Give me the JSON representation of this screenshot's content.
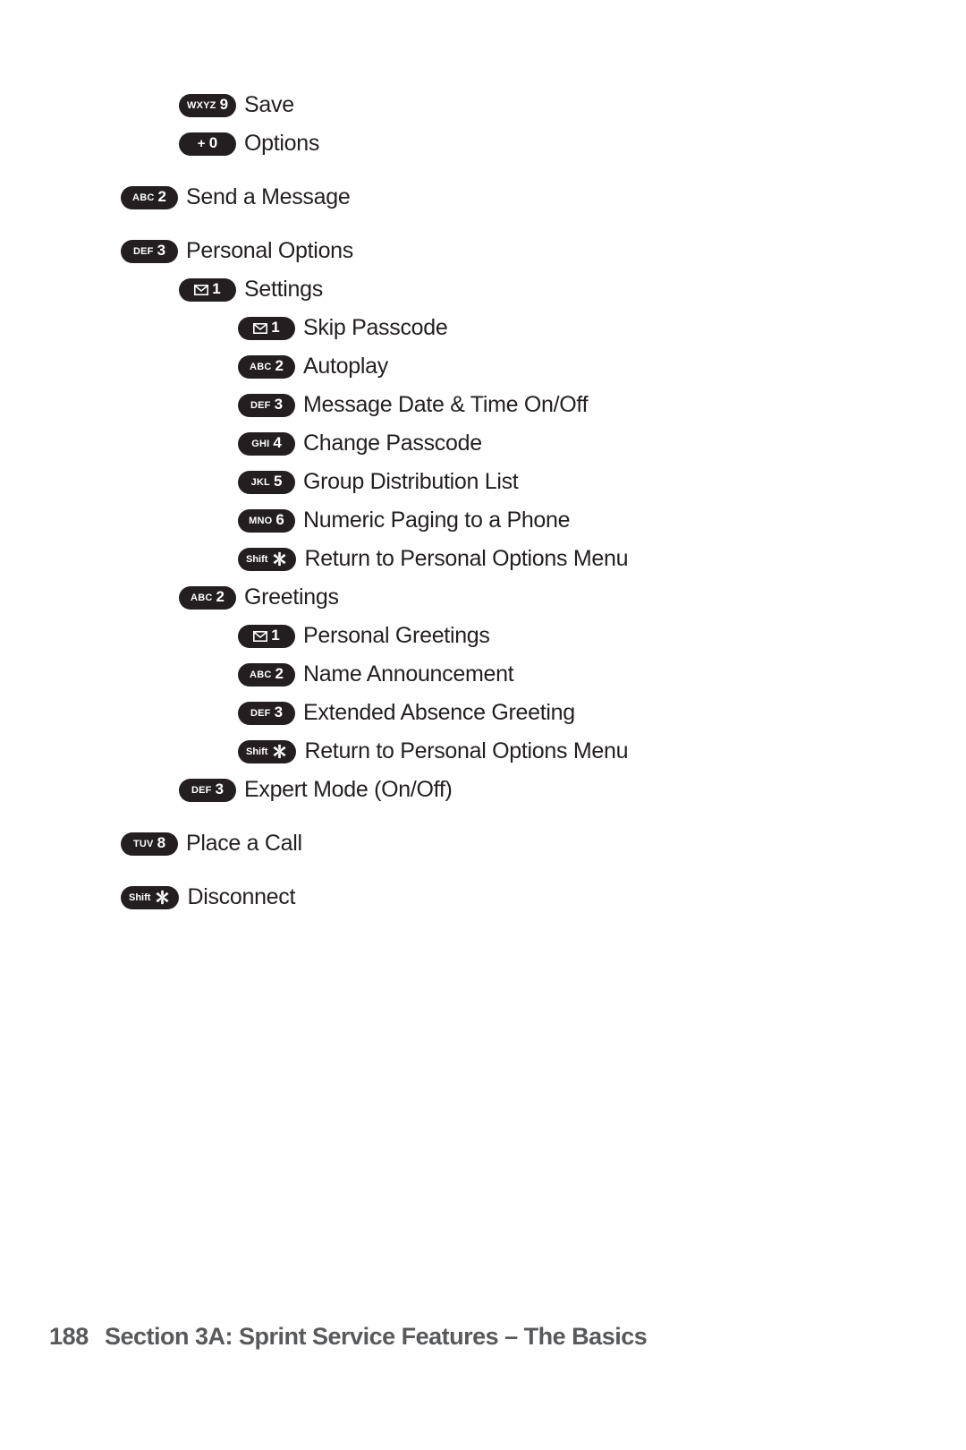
{
  "page": {
    "background_color": "#ffffff",
    "text_color": "#231f20",
    "key_color": "#231f20",
    "footer_color": "#58595b"
  },
  "menu": {
    "rows": [
      {
        "level": 1,
        "key": {
          "sub": "WXYZ",
          "digit": "9",
          "glyph": "none"
        },
        "label": "Save",
        "gap_before": false
      },
      {
        "level": 1,
        "key": {
          "sub": "+",
          "digit": "0",
          "glyph": "none"
        },
        "label": "Options",
        "gap_before": false
      },
      {
        "level": 0,
        "key": {
          "sub": "ABC",
          "digit": "2",
          "glyph": "none"
        },
        "label": "Send a Message",
        "gap_before": true
      },
      {
        "level": 0,
        "key": {
          "sub": "DEF",
          "digit": "3",
          "glyph": "none"
        },
        "label": "Personal Options",
        "gap_before": true
      },
      {
        "level": 1,
        "key": {
          "sub": "",
          "digit": "1",
          "glyph": "envelope"
        },
        "label": "Settings",
        "gap_before": false
      },
      {
        "level": 2,
        "key": {
          "sub": "",
          "digit": "1",
          "glyph": "envelope"
        },
        "label": "Skip Passcode",
        "gap_before": false
      },
      {
        "level": 2,
        "key": {
          "sub": "ABC",
          "digit": "2",
          "glyph": "none"
        },
        "label": "Autoplay",
        "gap_before": false
      },
      {
        "level": 2,
        "key": {
          "sub": "DEF",
          "digit": "3",
          "glyph": "none"
        },
        "label": "Message Date & Time On/Off",
        "gap_before": false
      },
      {
        "level": 2,
        "key": {
          "sub": "GHI",
          "digit": "4",
          "glyph": "none"
        },
        "label": "Change Passcode",
        "gap_before": false
      },
      {
        "level": 2,
        "key": {
          "sub": "JKL",
          "digit": "5",
          "glyph": "none"
        },
        "label": "Group Distribution List",
        "gap_before": false
      },
      {
        "level": 2,
        "key": {
          "sub": "MNO",
          "digit": "6",
          "glyph": "none"
        },
        "label": "Numeric Paging to a Phone",
        "gap_before": false
      },
      {
        "level": 2,
        "key": {
          "sub": "Shift",
          "digit": "",
          "glyph": "star"
        },
        "label": "Return to Personal Options Menu",
        "gap_before": false
      },
      {
        "level": 1,
        "key": {
          "sub": "ABC",
          "digit": "2",
          "glyph": "none"
        },
        "label": "Greetings",
        "gap_before": false
      },
      {
        "level": 2,
        "key": {
          "sub": "",
          "digit": "1",
          "glyph": "envelope"
        },
        "label": "Personal Greetings",
        "gap_before": false
      },
      {
        "level": 2,
        "key": {
          "sub": "ABC",
          "digit": "2",
          "glyph": "none"
        },
        "label": "Name Announcement",
        "gap_before": false
      },
      {
        "level": 2,
        "key": {
          "sub": "DEF",
          "digit": "3",
          "glyph": "none"
        },
        "label": "Extended Absence Greeting",
        "gap_before": false
      },
      {
        "level": 2,
        "key": {
          "sub": "Shift",
          "digit": "",
          "glyph": "star"
        },
        "label": "Return to Personal Options Menu",
        "gap_before": false
      },
      {
        "level": 1,
        "key": {
          "sub": "DEF",
          "digit": "3",
          "glyph": "none"
        },
        "label": "Expert Mode (On/Off)",
        "gap_before": false
      },
      {
        "level": 0,
        "key": {
          "sub": "TUV",
          "digit": "8",
          "glyph": "none"
        },
        "label": "Place a Call",
        "gap_before": true
      },
      {
        "level": 0,
        "key": {
          "sub": "Shift",
          "digit": "",
          "glyph": "star"
        },
        "label": "Disconnect",
        "gap_before": true
      }
    ]
  },
  "footer": {
    "page_number": "188",
    "title": "Section 3A: Sprint Service Features – The Basics"
  }
}
